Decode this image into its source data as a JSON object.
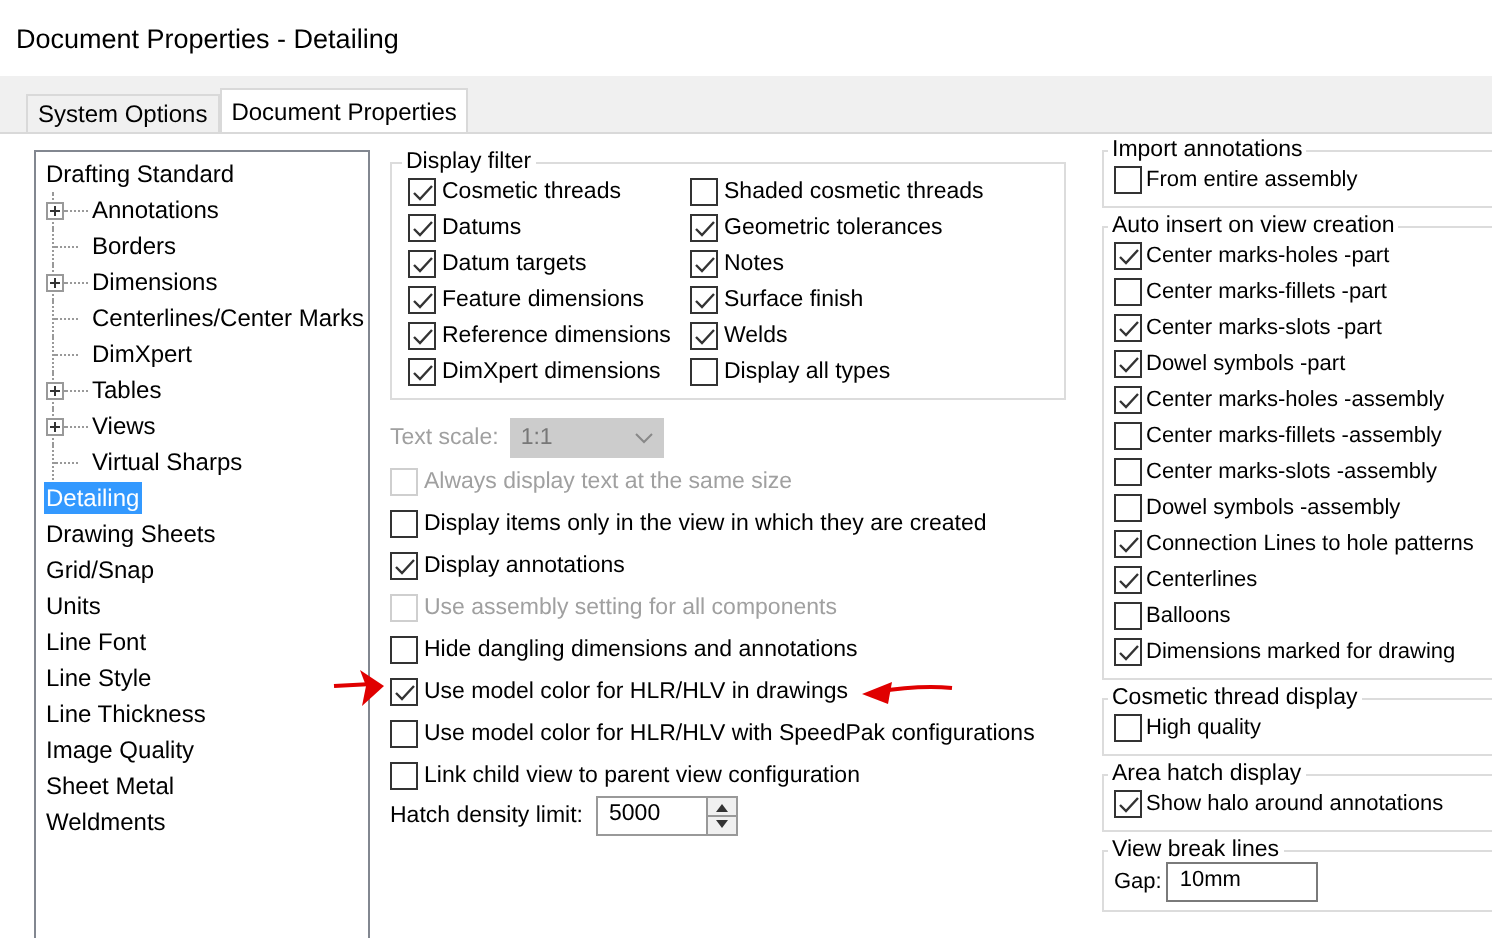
{
  "window": {
    "title": "Document Properties - Detailing"
  },
  "tabs": [
    {
      "label": "System Options",
      "selected": false
    },
    {
      "label": "Document Properties",
      "selected": true
    }
  ],
  "tree": [
    {
      "label": "Drafting Standard",
      "selected": false,
      "children": [
        {
          "label": "Annotations",
          "expandable": true,
          "selected": false
        },
        {
          "label": "Borders",
          "expandable": false,
          "selected": false
        },
        {
          "label": "Dimensions",
          "expandable": true,
          "selected": false
        },
        {
          "label": "Centerlines/Center Marks",
          "expandable": false,
          "selected": false
        },
        {
          "label": "DimXpert",
          "expandable": false,
          "selected": false
        },
        {
          "label": "Tables",
          "expandable": true,
          "selected": false
        },
        {
          "label": "Views",
          "expandable": true,
          "selected": false
        },
        {
          "label": "Virtual Sharps",
          "expandable": false,
          "selected": false
        }
      ]
    },
    {
      "label": "Detailing",
      "selected": true
    },
    {
      "label": "Drawing Sheets",
      "selected": false
    },
    {
      "label": "Grid/Snap",
      "selected": false
    },
    {
      "label": "Units",
      "selected": false
    },
    {
      "label": "Line Font",
      "selected": false
    },
    {
      "label": "Line Style",
      "selected": false
    },
    {
      "label": "Line Thickness",
      "selected": false
    },
    {
      "label": "Image Quality",
      "selected": false
    },
    {
      "label": "Sheet Metal",
      "selected": false
    },
    {
      "label": "Weldments",
      "selected": false
    }
  ],
  "display_filter": {
    "title": "Display filter",
    "items": [
      {
        "label": "Cosmetic threads",
        "checked": true
      },
      {
        "label": "Datums",
        "checked": true
      },
      {
        "label": "Datum targets",
        "checked": true
      },
      {
        "label": "Feature dimensions",
        "checked": true
      },
      {
        "label": "Reference dimensions",
        "checked": true
      },
      {
        "label": "DimXpert dimensions",
        "checked": true
      },
      {
        "label": "Shaded cosmetic threads",
        "checked": false
      },
      {
        "label": "Geometric tolerances",
        "checked": true
      },
      {
        "label": "Notes",
        "checked": true
      },
      {
        "label": "Surface finish",
        "checked": true
      },
      {
        "label": "Welds",
        "checked": true
      },
      {
        "label": "Display all types",
        "checked": false
      }
    ]
  },
  "text_scale": {
    "label": "Text scale:",
    "value": "1:1",
    "disabled": true
  },
  "options": [
    {
      "label": "Always display text at the same size",
      "checked": false,
      "disabled": true
    },
    {
      "label": "Display items only in the view in which they are created",
      "checked": false,
      "disabled": false
    },
    {
      "label": "Display annotations",
      "checked": true,
      "disabled": false
    },
    {
      "label": "Use assembly setting for all components",
      "checked": false,
      "disabled": true
    },
    {
      "label": "Hide dangling dimensions and annotations",
      "checked": false,
      "disabled": false
    },
    {
      "label": "Use model color for HLR/HLV in drawings",
      "checked": true,
      "disabled": false
    },
    {
      "label": "Use model color for HLR/HLV with SpeedPak configurations",
      "checked": false,
      "disabled": false
    },
    {
      "label": "Link child view to parent view configuration",
      "checked": false,
      "disabled": false
    }
  ],
  "hatch_density": {
    "label": "Hatch density limit:",
    "value": "5000"
  },
  "right_groups": [
    {
      "kind": "checks",
      "title": "Import annotations",
      "items": [
        {
          "label": "From entire assembly",
          "checked": false
        }
      ]
    },
    {
      "kind": "checks",
      "title": "Auto insert on view creation",
      "items": [
        {
          "label": "Center marks-holes -part",
          "checked": true
        },
        {
          "label": "Center marks-fillets -part",
          "checked": false
        },
        {
          "label": "Center marks-slots  -part",
          "checked": true
        },
        {
          "label": "Dowel symbols -part",
          "checked": true
        },
        {
          "label": "Center marks-holes -assembly",
          "checked": true
        },
        {
          "label": "Center marks-fillets -assembly",
          "checked": false
        },
        {
          "label": "Center marks-slots  -assembly",
          "checked": false
        },
        {
          "label": "Dowel symbols -assembly",
          "checked": false
        },
        {
          "label": "Connection Lines to hole patterns",
          "checked": true
        },
        {
          "label": "Centerlines",
          "checked": true
        },
        {
          "label": "Balloons",
          "checked": false
        },
        {
          "label": "Dimensions marked for drawing",
          "checked": true
        }
      ]
    },
    {
      "kind": "checks",
      "title": "Cosmetic thread display",
      "items": [
        {
          "label": "High quality",
          "checked": false
        }
      ]
    },
    {
      "kind": "checks",
      "title": "Area hatch display",
      "items": [
        {
          "label": "Show halo around annotations",
          "checked": true
        }
      ]
    },
    {
      "kind": "field",
      "title": "View break lines",
      "field": {
        "label": "Gap:",
        "value": "10mm"
      }
    }
  ]
}
